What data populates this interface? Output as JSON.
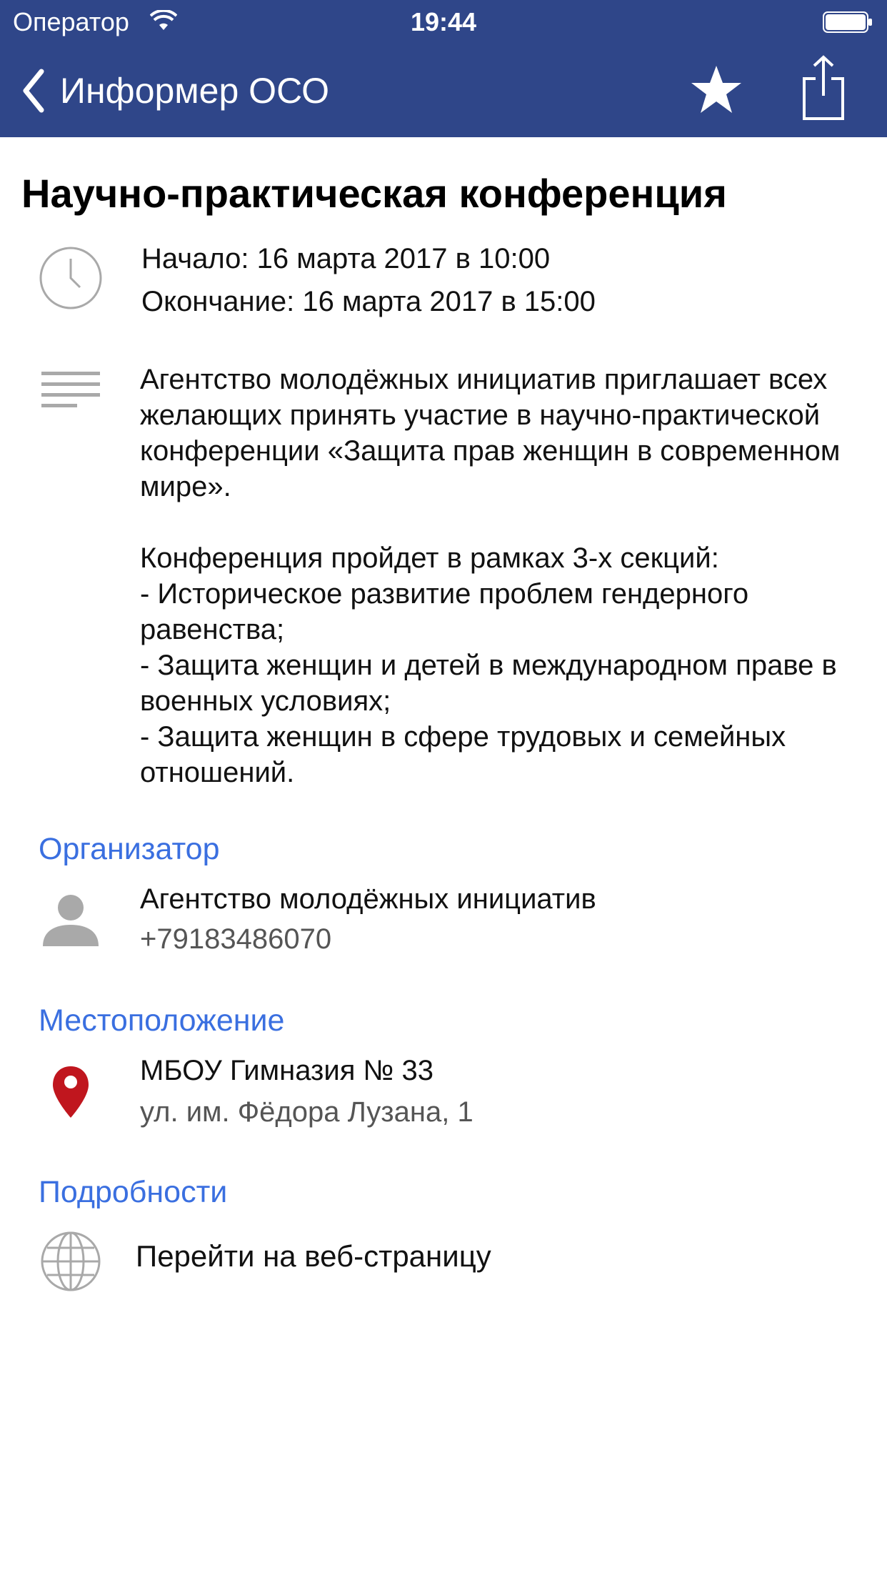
{
  "status_bar": {
    "carrier": "Оператор",
    "time": "19:44"
  },
  "nav": {
    "back_label": "Информер ОСО",
    "favorite_icon": "star-icon",
    "share_icon": "share-icon"
  },
  "event": {
    "title": "Научно-практическая конференция",
    "start": "Начало: 16 марта 2017 в 10:00",
    "end": "Окончание: 16 марта 2017 в 15:00",
    "description_paragraphs": [
      "Агентство молодёжных инициатив приглашает всех желающих принять участие в научно-практической конференции «Защита прав женщин в современном мире».",
      "Конференция пройдет в рамках 3-х секций:",
      "-  Историческое развитие проблем гендерного равенства;",
      "-  Защита женщин и детей в международном праве в военных условиях;",
      "-  Защита женщин в сфере трудовых и семейных отношений."
    ]
  },
  "organizer": {
    "heading": "Организатор",
    "name": "Агентство молодёжных инициатив",
    "phone": "+79183486070"
  },
  "location": {
    "heading": "Местоположение",
    "place": "МБОУ Гимназия № 33",
    "address": "ул. им. Фёдора Лузана, 1"
  },
  "details": {
    "heading": "Подробности",
    "link_label": "Перейти на веб-страницу"
  },
  "colors": {
    "nav_background": "#2f4689",
    "section_heading": "#3a6fe0",
    "pin": "#c0161e",
    "icon_gray": "#a9a9a9"
  }
}
